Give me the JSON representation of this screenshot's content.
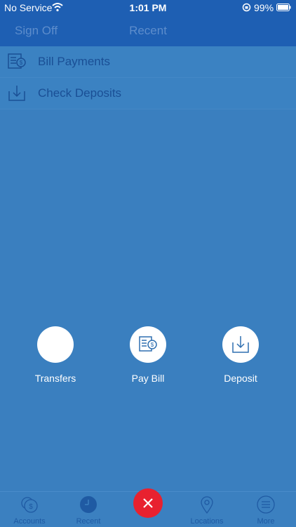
{
  "status_bar": {
    "carrier": "No Service",
    "time": "1:01 PM",
    "battery": "99%"
  },
  "nav": {
    "left_button": "Sign Off",
    "title": "Recent"
  },
  "menu": {
    "items": [
      {
        "label": "Bill Payments",
        "icon": "bill-icon"
      },
      {
        "label": "Check Deposits",
        "icon": "download-tray-icon"
      }
    ]
  },
  "actions": [
    {
      "label": "Transfers",
      "icon": "blank"
    },
    {
      "label": "Pay Bill",
      "icon": "bill-icon"
    },
    {
      "label": "Deposit",
      "icon": "download-tray-icon"
    }
  ],
  "tabs": [
    {
      "label": "Accounts",
      "icon": "accounts-icon"
    },
    {
      "label": "Recent",
      "icon": "clock-icon"
    },
    {
      "label": "Locations",
      "icon": "map-pin-icon"
    },
    {
      "label": "More",
      "icon": "menu-icon"
    }
  ],
  "colors": {
    "accent_red": "#e8212f",
    "nav_blue": "#1e5fb3",
    "overlay_blue": "#3a7fbf"
  }
}
